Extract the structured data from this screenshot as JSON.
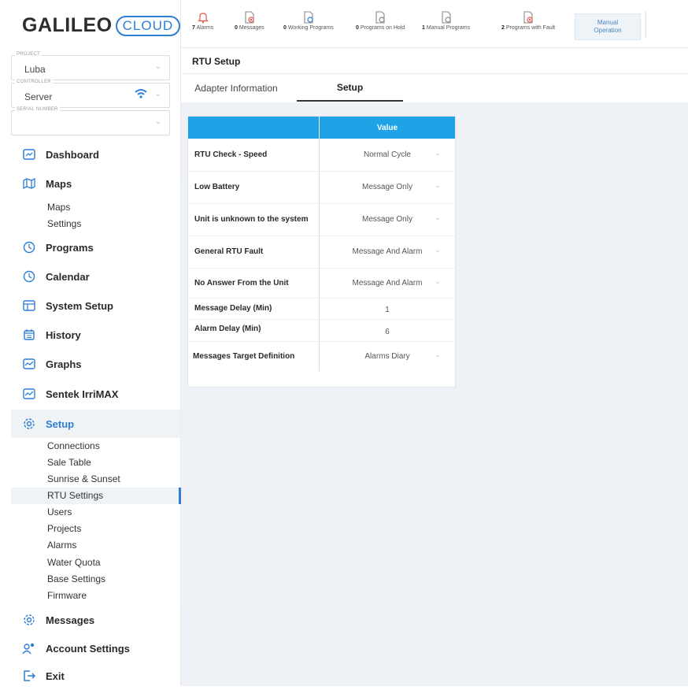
{
  "logo": {
    "brand": "GALILEO",
    "cloud": "CLOUD",
    "collapse": "«"
  },
  "selectors": {
    "project": {
      "label": "PROJECT",
      "value": "Luba"
    },
    "controller": {
      "label": "CONTROLLER",
      "value": "Server"
    },
    "serial": {
      "label": "SERIAL NUMBER",
      "value": ""
    }
  },
  "nav": {
    "dashboard": "Dashboard",
    "maps": "Maps",
    "maps_sub": [
      "Maps",
      "Settings"
    ],
    "programs": "Programs",
    "calendar": "Calendar",
    "system_setup": "System Setup",
    "history": "History",
    "graphs": "Graphs",
    "sentek": "Sentek IrriMAX",
    "setup": "Setup",
    "setup_sub": [
      "Connections",
      "Sale Table",
      "Sunrise & Sunset",
      "RTU Settings",
      "Users",
      "Projects",
      "Alarms",
      "Water Quota",
      "Base Settings",
      "Firmware"
    ],
    "messages": "Messages",
    "account_settings": "Account Settings",
    "exit": "Exit"
  },
  "status_bar": {
    "alarms": {
      "count": "7",
      "label": "Alarms"
    },
    "messages": {
      "count": "0",
      "label": "Messages"
    },
    "working": {
      "count": "0",
      "label": "Working Programs"
    },
    "on_hold": {
      "count": "0",
      "label": "Programs on Hold"
    },
    "manual": {
      "count": "1",
      "label": "Manual Programs"
    },
    "fault": {
      "count": "2",
      "label": "Programs with Fault"
    },
    "manual_operation": {
      "line1": "Manual",
      "line2": "Operation"
    }
  },
  "page": {
    "title": "RTU Setup",
    "tabs": [
      "Adapter Information",
      "Setup"
    ]
  },
  "table": {
    "header_value": "Value",
    "rows": [
      {
        "name": "RTU Check - Speed",
        "value": "Normal Cycle"
      },
      {
        "name": "Low Battery",
        "value": "Message Only"
      },
      {
        "name": "Unit is unknown to the system",
        "value": "Message Only"
      },
      {
        "name": "General RTU Fault",
        "value": "Message And Alarm"
      },
      {
        "name": "No Answer From the Unit",
        "value": "Message And Alarm"
      },
      {
        "name": "Message Delay (Min)",
        "value": "1"
      },
      {
        "name": "Alarm Delay (Min)",
        "value": "6"
      },
      {
        "name": "Messages Target Definition",
        "value": "Alarms Diary"
      }
    ]
  },
  "colors": {
    "accent": "#2c7fd4",
    "table_header": "#1fa3e6",
    "alarm_red": "#e2574c",
    "background": "#eef1f5"
  },
  "icons": [
    "bell-icon",
    "message-doc-icon",
    "program-doc-icon",
    "wifi-icon",
    "chevron-down-icon",
    "dashboard-icon",
    "map-icon",
    "clock-icon",
    "table-icon",
    "calendar-icon",
    "graph-icon",
    "gear-icon",
    "users-icon",
    "exit-icon"
  ]
}
